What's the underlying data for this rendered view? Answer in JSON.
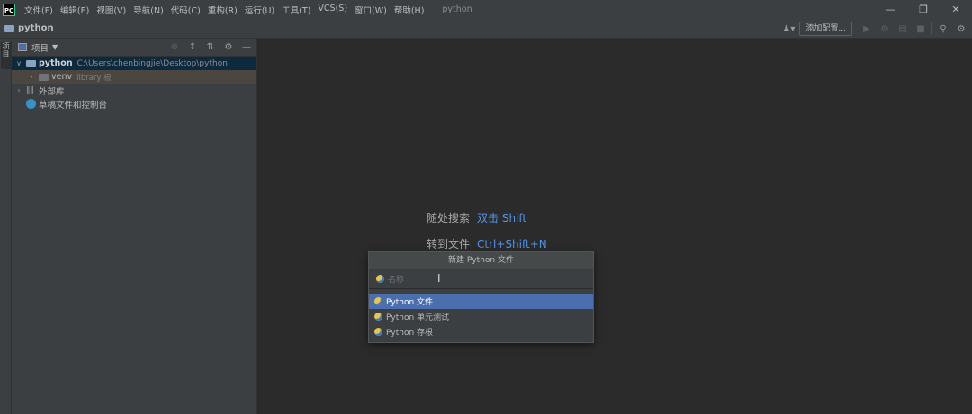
{
  "menubar": {
    "logo": "PC",
    "items": [
      "文件(F)",
      "编辑(E)",
      "视图(V)",
      "导航(N)",
      "代码(C)",
      "重构(R)",
      "运行(U)",
      "工具(T)",
      "VCS(S)",
      "窗口(W)",
      "帮助(H)"
    ],
    "window_title": "python",
    "controls": [
      "—",
      "❐",
      "✕"
    ]
  },
  "navbar": {
    "project": "python",
    "add_config": "添加配置..."
  },
  "left_stripe": {
    "tab": "项目"
  },
  "project_panel": {
    "title": "项目",
    "tree": {
      "root_name": "python",
      "root_path": "C:\\Users\\chenbingjie\\Desktop\\python",
      "venv_name": "venv",
      "venv_label": "library 根",
      "external_libs": "外部库",
      "scratches": "草稿文件和控制台"
    }
  },
  "editor": {
    "hint1_label": "随处搜索",
    "hint1_key": "双击 Shift",
    "hint2_label": "转到文件",
    "hint2_key": "Ctrl+Shift+N"
  },
  "popup": {
    "title": "新建 Python 文件",
    "placeholder": "名称",
    "items": [
      "Python 文件",
      "Python 单元测试",
      "Python 存根"
    ],
    "selected_index": 0
  },
  "colors": {
    "accent": "#4b6eaf",
    "link": "#5394ec",
    "background": "#2b2b2b",
    "panel": "#3c3f41"
  }
}
